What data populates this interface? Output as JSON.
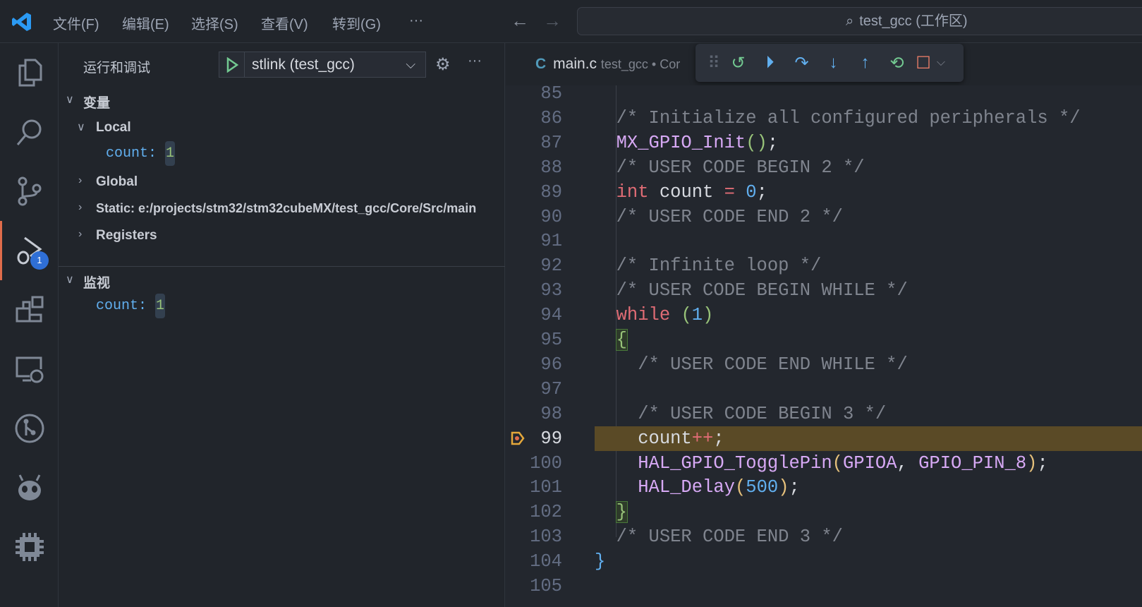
{
  "titlebar": {
    "menus": [
      "文件(F)",
      "编辑(E)",
      "选择(S)",
      "查看(V)",
      "转到(G)",
      "···"
    ],
    "search": "test_gcc (工作区)"
  },
  "activity": {
    "debug_badge": "1"
  },
  "sidebar": {
    "title": "运行和调试",
    "config": "stlink (test_gcc)",
    "variables_header": "变量",
    "local": "Local",
    "local_var": {
      "name": "count:",
      "value": "1"
    },
    "global": "Global",
    "static": "Static: e:/projects/stm32/stm32cubeMX/test_gcc/Core/Src/main",
    "registers": "Registers",
    "watch_header": "监视",
    "watch_var": {
      "name": "count:",
      "value": "1"
    }
  },
  "tab": {
    "icon": "C",
    "name": "main.c",
    "path": "test_gcc • Cor"
  },
  "editor": {
    "current_line": 99,
    "lines": [
      {
        "n": "85",
        "t": []
      },
      {
        "n": "86",
        "t": [
          [
            "  /* Initialize all configured peripherals */",
            "cmt"
          ]
        ]
      },
      {
        "n": "87",
        "t": [
          [
            "  ",
            ""
          ],
          [
            "MX_GPIO_Init",
            "fn2"
          ],
          [
            "()",
            "p"
          ],
          [
            ";",
            "t"
          ]
        ]
      },
      {
        "n": "88",
        "t": [
          [
            "  /* USER CODE BEGIN 2 */",
            "cmt"
          ]
        ]
      },
      {
        "n": "89",
        "t": [
          [
            "  ",
            ""
          ],
          [
            "int",
            "kw"
          ],
          [
            " count ",
            "t"
          ],
          [
            "=",
            "op"
          ],
          [
            " ",
            "t"
          ],
          [
            "0",
            "num"
          ],
          [
            ";",
            "t"
          ]
        ]
      },
      {
        "n": "90",
        "t": [
          [
            "  /* USER CODE END 2 */",
            "cmt"
          ]
        ]
      },
      {
        "n": "91",
        "t": []
      },
      {
        "n": "92",
        "t": [
          [
            "  /* Infinite loop */",
            "cmt"
          ]
        ]
      },
      {
        "n": "93",
        "t": [
          [
            "  /* USER CODE BEGIN WHILE */",
            "cmt"
          ]
        ]
      },
      {
        "n": "94",
        "t": [
          [
            "  ",
            ""
          ],
          [
            "while",
            "kw"
          ],
          [
            " ",
            "t"
          ],
          [
            "(",
            "p"
          ],
          [
            "1",
            "num"
          ],
          [
            ")",
            "p"
          ]
        ]
      },
      {
        "n": "95",
        "t": [
          [
            "  ",
            ""
          ],
          [
            "{",
            "p"
          ]
        ]
      },
      {
        "n": "96",
        "t": [
          [
            "    /* USER CODE END WHILE */",
            "cmt"
          ]
        ]
      },
      {
        "n": "97",
        "t": []
      },
      {
        "n": "98",
        "t": [
          [
            "    /* USER CODE BEGIN 3 */",
            "cmt"
          ]
        ]
      },
      {
        "n": "99",
        "t": [
          [
            "    ",
            ""
          ],
          [
            "count",
            "t"
          ],
          [
            "++",
            "op"
          ],
          [
            ";",
            "t"
          ]
        ]
      },
      {
        "n": "100",
        "t": [
          [
            "    ",
            ""
          ],
          [
            "HAL_GPIO_TogglePin",
            "fn2"
          ],
          [
            "(",
            "y"
          ],
          [
            "GPIOA",
            "fn2"
          ],
          [
            ", ",
            "t"
          ],
          [
            "GPIO_PIN_8",
            "fn2"
          ],
          [
            ")",
            "y"
          ],
          [
            ";",
            "t"
          ]
        ]
      },
      {
        "n": "101",
        "t": [
          [
            "    ",
            ""
          ],
          [
            "HAL_Delay",
            "fn2"
          ],
          [
            "(",
            "y"
          ],
          [
            "500",
            "num"
          ],
          [
            ")",
            "y"
          ],
          [
            ";",
            "t"
          ]
        ]
      },
      {
        "n": "102",
        "t": [
          [
            "  ",
            ""
          ],
          [
            "}",
            "p"
          ]
        ]
      },
      {
        "n": "103",
        "t": [
          [
            "  /* USER CODE END 3 */",
            "cmt"
          ]
        ]
      },
      {
        "n": "104",
        "t": [
          [
            "}",
            "num"
          ]
        ]
      },
      {
        "n": "105",
        "t": []
      }
    ]
  }
}
